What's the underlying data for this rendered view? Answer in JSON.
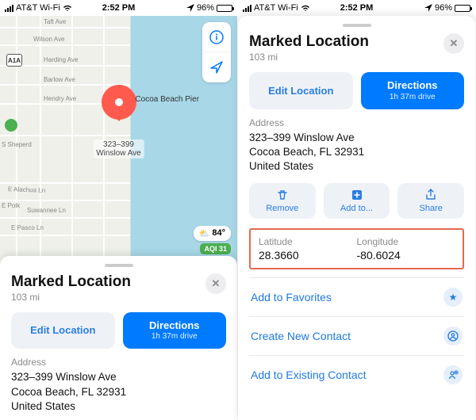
{
  "status": {
    "carrier": "AT&T Wi-Fi",
    "time": "2:52 PM",
    "battery_pct": "96%"
  },
  "map": {
    "shield_label": "A1A",
    "pier_label": "Cocoa Beach Pier",
    "pin_address": "323–399\nWinslow Ave",
    "streets": {
      "taft": "Taft Ave",
      "wilson": "Wilson Ave",
      "harding": "Harding Ave",
      "barlow": "Barlow Ave",
      "hendry": "Hendry Ave",
      "sheperd": "S Sheperd",
      "alachua": "E Alachua Ln",
      "polk": "E Polk",
      "suwannee": "Suwannee Ln",
      "pasco": "E Pasco Ln"
    },
    "weather_temp": "84°",
    "aqi": "AQI 31"
  },
  "sheet": {
    "title": "Marked Location",
    "distance": "103 mi",
    "edit_label": "Edit Location",
    "directions_label": "Directions",
    "directions_sub": "1h 37m drive",
    "address_label": "Address",
    "address_line1": "323–399 Winslow Ave",
    "address_line2": "Cocoa Beach, FL  32931",
    "address_line3": "United States",
    "remove_label": "Remove",
    "addto_label": "Add to...",
    "share_label": "Share",
    "lat_label": "Latitude",
    "lat_val": "28.3660",
    "lon_label": "Longitude",
    "lon_val": "-80.6024",
    "fav_label": "Add to Favorites",
    "new_contact_label": "Create New Contact",
    "existing_contact_label": "Add to Existing Contact"
  }
}
